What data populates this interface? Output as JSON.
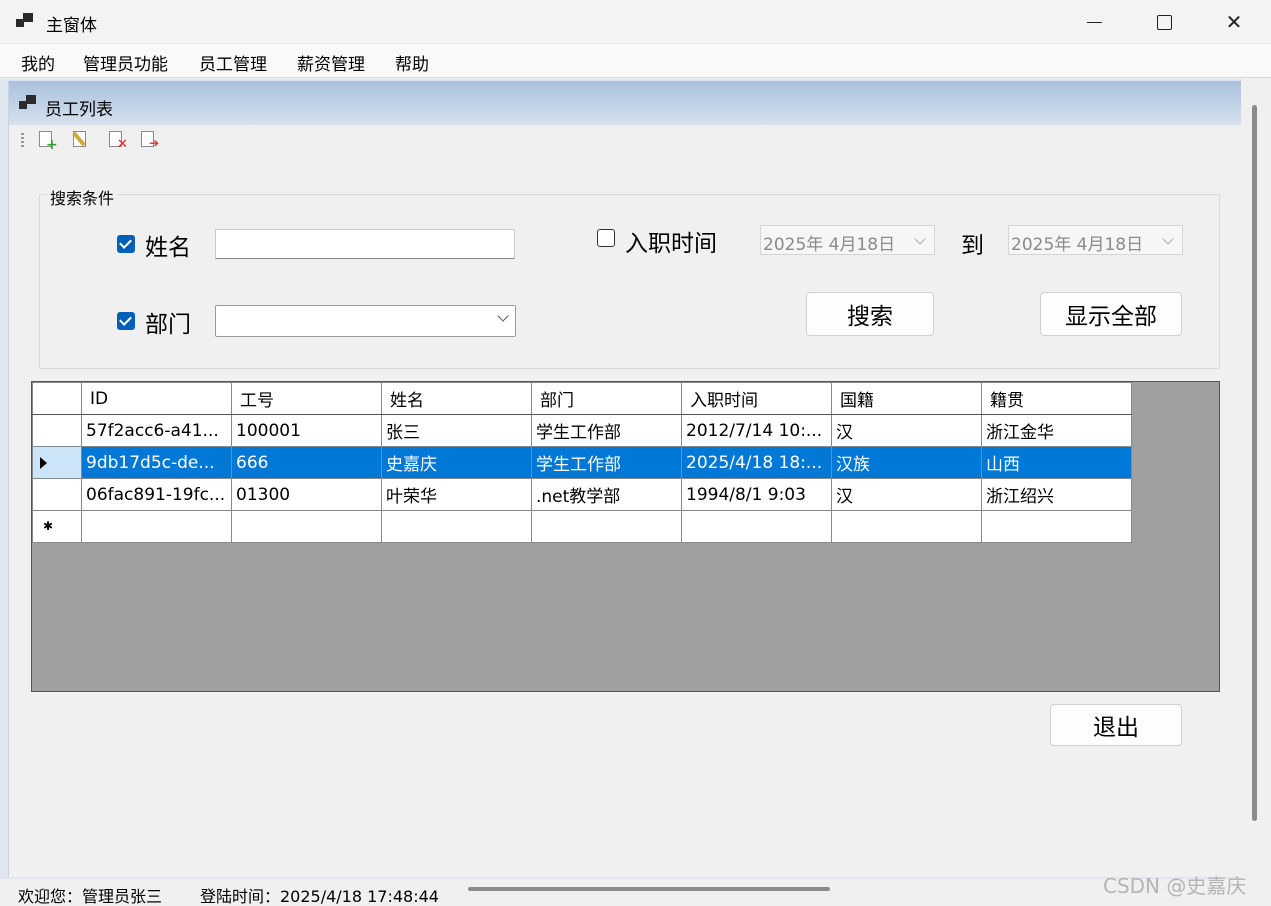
{
  "window": {
    "title": "主窗体"
  },
  "menu": [
    "我的",
    "管理员功能",
    "员工管理",
    "薪资管理",
    "帮助"
  ],
  "child": {
    "title": "员工列表",
    "toolbar": [
      "add-icon",
      "edit-icon",
      "delete-icon",
      "export-icon"
    ]
  },
  "search": {
    "group_title": "搜索条件",
    "name_label": "姓名",
    "name_checked": true,
    "name_value": "",
    "dept_label": "部门",
    "dept_checked": true,
    "dept_value": "",
    "hire_label": "入职时间",
    "hire_checked": false,
    "date_from": "2025年  4月18日",
    "to_label": "到",
    "date_to": "2025年  4月18日",
    "search_button": "搜索",
    "show_all_button": "显示全部"
  },
  "grid": {
    "columns": [
      "ID",
      "工号",
      "姓名",
      "部门",
      "入职时间",
      "国籍",
      "籍贯"
    ],
    "rows": [
      [
        "57f2acc6-a41...",
        "100001",
        "张三",
        "学生工作部",
        "2012/7/14 10:...",
        "汉",
        "浙江金华"
      ],
      [
        "9db17d5c-de...",
        "666",
        "史嘉庆",
        "学生工作部",
        "2025/4/18 18:...",
        "汉族",
        "山西"
      ],
      [
        "06fac891-19fc...",
        "01300",
        "叶荣华",
        ".net教学部",
        "1994/8/1 9:03",
        "汉",
        "浙江绍兴"
      ]
    ],
    "selected_row": 1
  },
  "exit_button": "退出",
  "status": {
    "welcome": "欢迎您：管理员张三",
    "login_time": "登陆时间：2025/4/18 17:48:44"
  },
  "watermark": "CSDN @史嘉庆",
  "colors": {
    "selection": "#0078d7",
    "checkbox": "#005fb8",
    "grid_bg": "#a0a0a0"
  }
}
